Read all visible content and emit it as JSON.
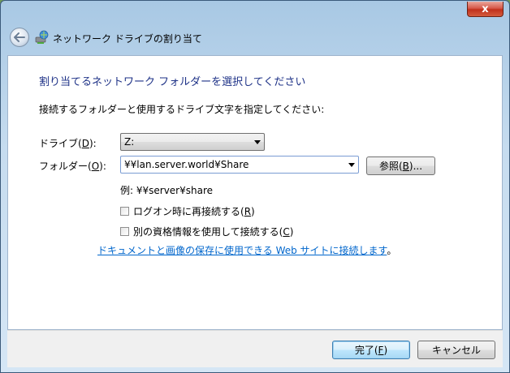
{
  "window": {
    "title": "ネットワーク ドライブの割り当て",
    "close_label": "x"
  },
  "heading": "割り当てるネットワーク フォルダーを選択してください",
  "instruction": "接続するフォルダーと使用するドライブ文字を指定してください:",
  "drive": {
    "label_pre": "ドライブ(",
    "label_key": "D",
    "label_post": "):",
    "value": "Z:"
  },
  "folder": {
    "label_pre": "フォルダー(",
    "label_key": "O",
    "label_post": "):",
    "value": "¥¥lan.server.world¥Share",
    "browse_pre": "参照(",
    "browse_key": "B",
    "browse_post": ")..."
  },
  "example": "例: ¥¥server¥share",
  "reconnect": {
    "label_pre": "ログオン時に再接続する(",
    "label_key": "R",
    "label_post": ")",
    "checked": false
  },
  "credentials": {
    "label_pre": "別の資格情報を使用して接続する(",
    "label_key": "C",
    "label_post": ")",
    "checked": false
  },
  "link": {
    "text": "ドキュメントと画像の保存に使用できる Web サイトに接続します",
    "suffix": "。"
  },
  "footer": {
    "finish_pre": "完了(",
    "finish_key": "F",
    "finish_post": ")",
    "cancel": "キャンセル"
  },
  "colors": {
    "heading": "#1e3287",
    "link": "#0066cc",
    "close": "#c0301c"
  }
}
